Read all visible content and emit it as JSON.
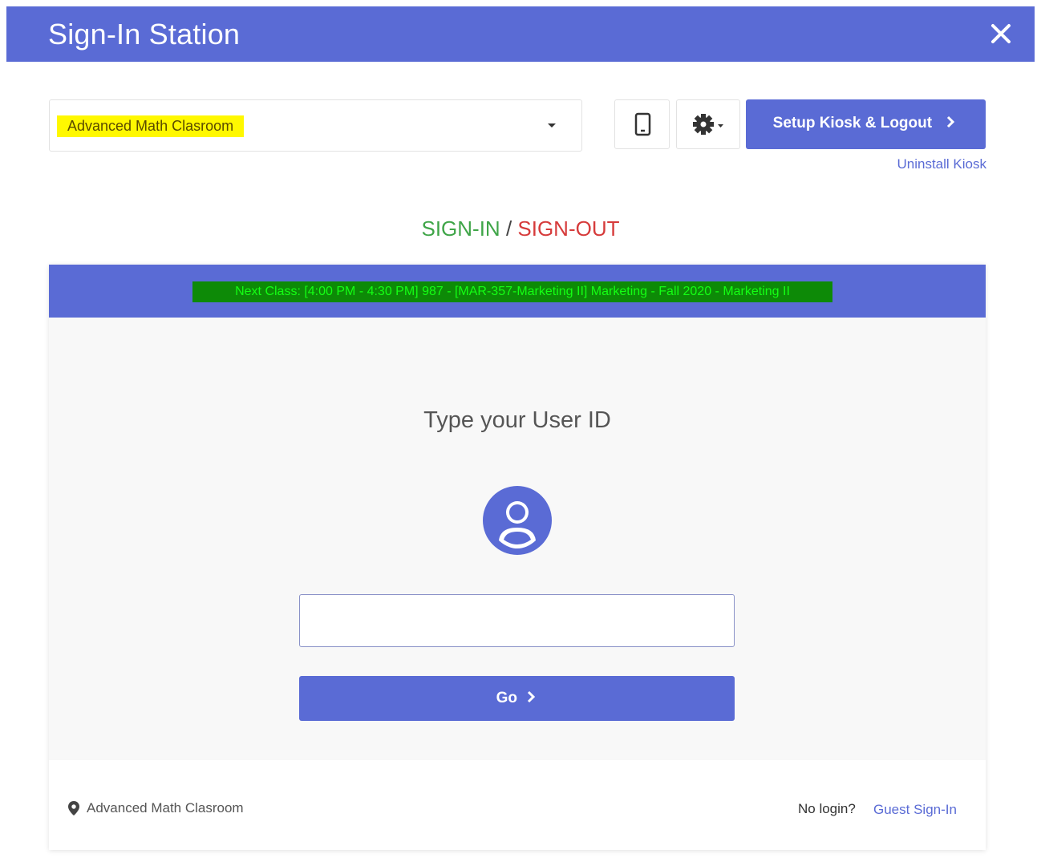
{
  "window": {
    "title": "Sign-In Station",
    "close_icon": "close-icon"
  },
  "toolbar": {
    "room_select_value": "Advanced Math Clasroom",
    "phone_icon": "mobile-phone-icon",
    "gear_icon": "gear-icon",
    "setup_label": "Setup Kiosk & Logout",
    "uninstall_label": "Uninstall Kiosk"
  },
  "heading": {
    "sign_in": "SIGN-IN",
    "separator": " / ",
    "sign_out": "SIGN-OUT"
  },
  "banner": {
    "next_class": "Next Class: [4:00 PM - 4:30 PM] 987 - [MAR-357-Marketing II] Marketing - Fall 2020 - Marketing II"
  },
  "form": {
    "prompt": "Type your User ID",
    "user_id_value": "",
    "go_label": "Go"
  },
  "footer": {
    "location": "Advanced Math Clasroom",
    "no_login": "No login?",
    "guest_link": "Guest Sign-In"
  },
  "colors": {
    "primary": "#5a6bd5",
    "highlight_yellow": "#fff800",
    "banner_green_bg": "#0d8a07",
    "banner_green_text": "#14ff14",
    "sign_in_green": "#3fa548",
    "sign_out_red": "#d63b3b"
  }
}
